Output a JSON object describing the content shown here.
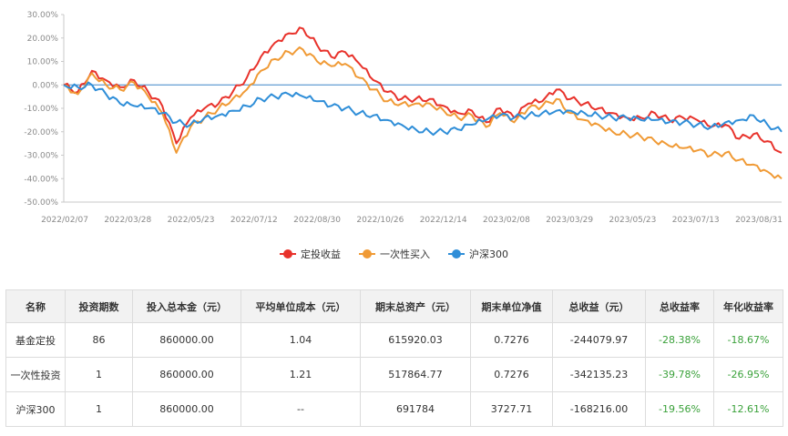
{
  "chart_data": {
    "type": "line",
    "x_ticks": [
      "2022/02/07",
      "2022/03/28",
      "2022/05/23",
      "2022/07/12",
      "2022/08/30",
      "2022/10/26",
      "2022/12/14",
      "2023/02/08",
      "2023/03/29",
      "2023/05/23",
      "2023/07/13",
      "2023/08/31"
    ],
    "y_ticks": [
      "30.00%",
      "20.00%",
      "10.00%",
      "0.00%",
      "-10.00%",
      "-20.00%",
      "-30.00%",
      "-40.00%",
      "-50.00%"
    ],
    "ylim": [
      -50,
      30
    ],
    "grid": false,
    "legend_position": "bottom",
    "series": [
      {
        "name": "定投收益",
        "color": "#e8322b",
        "values": [
          0,
          -3,
          6,
          2,
          -1,
          2,
          -3,
          -9,
          -25,
          -14,
          -10,
          -8,
          -3,
          3,
          12,
          18,
          22,
          24,
          17,
          12,
          14,
          9,
          2,
          -3,
          -6,
          -6,
          -6,
          -9,
          -12,
          -11,
          -16,
          -10,
          -14,
          -8,
          -7,
          -2,
          -6,
          -8,
          -10,
          -12,
          -14,
          -14,
          -12,
          -15,
          -14,
          -15,
          -18,
          -17,
          -23,
          -21,
          -24,
          -29
        ]
      },
      {
        "name": "一次性买入",
        "color": "#f09a35",
        "values": [
          0,
          -4,
          5,
          0,
          -2,
          1,
          -5,
          -12,
          -29,
          -18,
          -14,
          -10,
          -6,
          -2,
          6,
          11,
          14,
          15,
          10,
          8,
          9,
          3,
          -2,
          -7,
          -8,
          -8,
          -8,
          -11,
          -14,
          -13,
          -18,
          -12,
          -16,
          -10,
          -9,
          -6,
          -12,
          -15,
          -17,
          -20,
          -21,
          -22,
          -24,
          -26,
          -27,
          -28,
          -30,
          -29,
          -32,
          -34,
          -37,
          -40
        ]
      },
      {
        "name": "沪深300",
        "color": "#2f8ed8",
        "values": [
          0,
          -1,
          0,
          -4,
          -8,
          -9,
          -10,
          -12,
          -16,
          -17,
          -14,
          -13,
          -11,
          -9,
          -6,
          -5,
          -4,
          -5,
          -7,
          -9,
          -10,
          -12,
          -13,
          -15,
          -17,
          -19,
          -20,
          -20,
          -19,
          -17,
          -15,
          -13,
          -14,
          -13,
          -12,
          -11,
          -11,
          -12,
          -13,
          -14,
          -14,
          -15,
          -15,
          -16,
          -16,
          -17,
          -18,
          -16,
          -15,
          -13,
          -17,
          -20
        ]
      }
    ]
  },
  "table": {
    "headers": [
      "名称",
      "投资期数",
      "投入总本金（元）",
      "平均单位成本（元）",
      "期末总资产（元）",
      "期末单位净值",
      "总收益（元）",
      "总收益率",
      "年化收益率"
    ],
    "rows": [
      [
        "基金定投",
        "86",
        "860000.00",
        "1.04",
        "615920.03",
        "0.7276",
        "-244079.97",
        "-28.38%",
        "-18.67%"
      ],
      [
        "一次性投资",
        "1",
        "860000.00",
        "1.21",
        "517864.77",
        "0.7276",
        "-342135.23",
        "-39.78%",
        "-26.95%"
      ],
      [
        "沪深300",
        "1",
        "860000.00",
        "--",
        "691784",
        "3727.71",
        "-168216.00",
        "-19.56%",
        "-12.61%"
      ]
    ]
  }
}
